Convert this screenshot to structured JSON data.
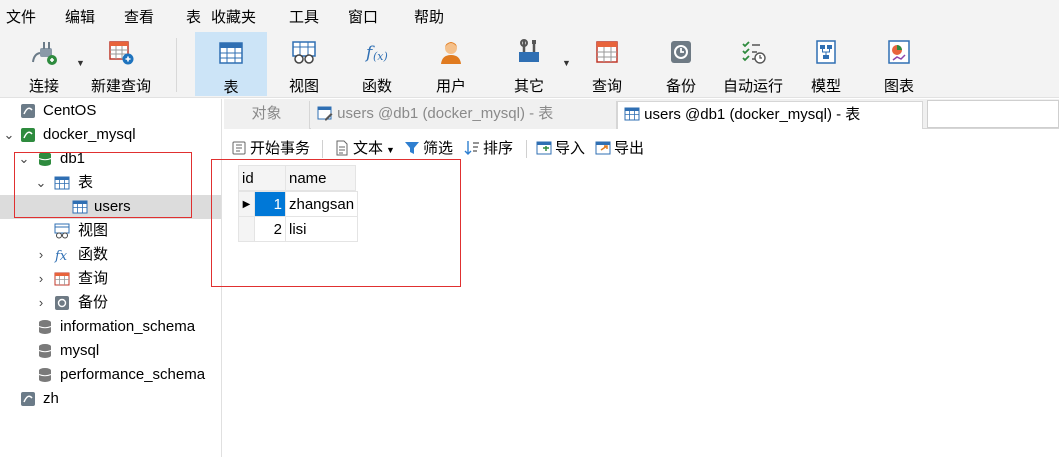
{
  "menu": [
    "文件",
    "编辑",
    "查看",
    "表",
    "收藏夹",
    "工具",
    "窗口",
    "帮助"
  ],
  "toolbar": {
    "connect": "连接",
    "new_query": "新建查询",
    "table": "表",
    "view": "视图",
    "function": "函数",
    "user": "用户",
    "other": "其它",
    "query": "查询",
    "backup": "备份",
    "automation": "自动运行",
    "model": "模型",
    "chart": "图表"
  },
  "tree": {
    "centos": "CentOS",
    "docker_mysql": "docker_mysql",
    "db1": "db1",
    "tables": "表",
    "users": "users",
    "views": "视图",
    "functions": "函数",
    "queries": "查询",
    "backups": "备份",
    "information_schema": "information_schema",
    "mysql": "mysql",
    "performance_schema": "performance_schema",
    "zh": "zh"
  },
  "tabs": {
    "objects": "对象",
    "tab1": "users @db1 (docker_mysql) - 表",
    "tab2": "users @db1 (docker_mysql) - 表"
  },
  "subbar": {
    "begin_transaction": "开始事务",
    "text": "文本",
    "filter": "筛选",
    "sort": "排序",
    "import": "导入",
    "export": "导出"
  },
  "grid": {
    "columns": [
      "id",
      "name"
    ],
    "rows": [
      {
        "id": "1",
        "name": "zhangsan"
      },
      {
        "id": "2",
        "name": "lisi"
      }
    ]
  },
  "colors": {
    "selection": "#0078d7",
    "active_tool": "#cce4f7",
    "annotation": "#e03030"
  }
}
